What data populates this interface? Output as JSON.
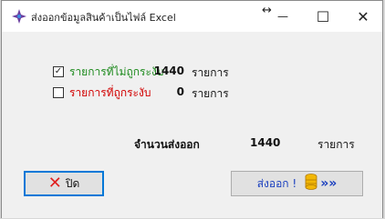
{
  "window": {
    "title": "ส่งออกข้อมูลสินค้าเป็นไฟล์ Excel",
    "resize_glyph": "↔",
    "minimize_glyph": "—",
    "maximize_glyph": "☐",
    "close_glyph": "✕"
  },
  "options": [
    {
      "label": "รายการที่ไม่ถูกระงับ",
      "checked": true,
      "count": "1440",
      "unit": "รายการ",
      "color": "#1d8a1d"
    },
    {
      "label": "รายการที่ถูกระงับ",
      "checked": false,
      "count": "0",
      "unit": "รายการ",
      "color": "#d20000"
    }
  ],
  "summary": {
    "label": "จำนวนส่งออก",
    "value": "1440",
    "unit": "รายการ"
  },
  "buttons": {
    "close_label": "ปิด",
    "close_icon": "x-icon",
    "export_label": "ส่งออก !",
    "export_icon": "database-icon",
    "export_arrows": "»»"
  },
  "colors": {
    "accent_blue": "#0078d7",
    "export_text": "#1a3fbf",
    "close_red": "#e02020"
  }
}
